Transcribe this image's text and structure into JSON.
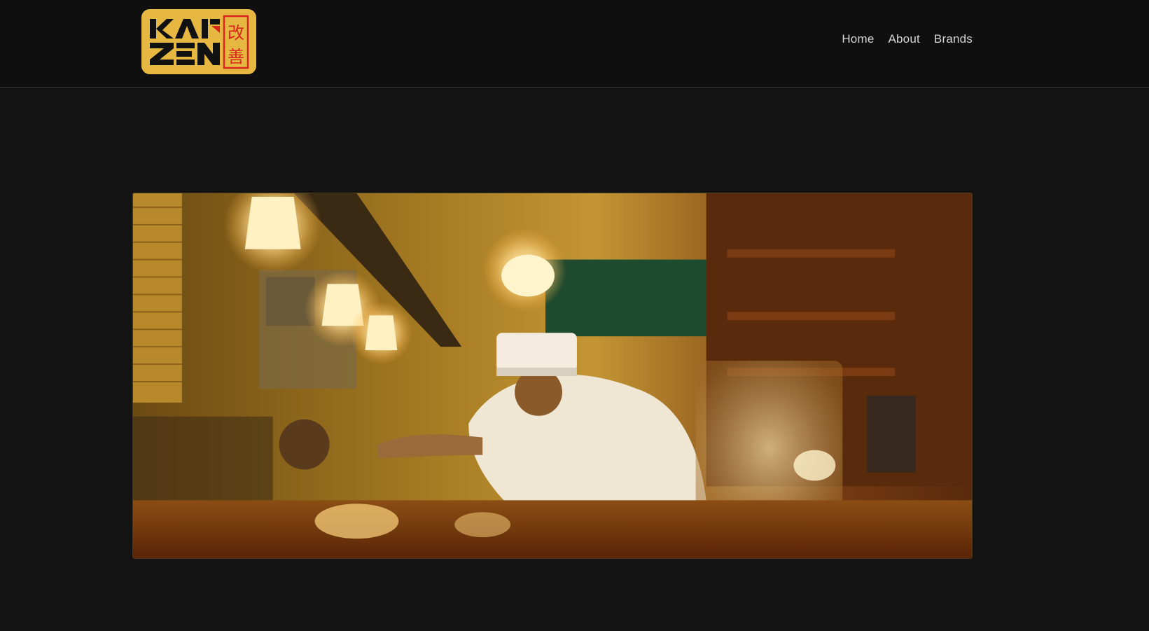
{
  "logo": {
    "latin_text": "KAIZEN",
    "kanji_top": "改",
    "kanji_bottom": "善",
    "colors": {
      "gold": "#E6B842",
      "black": "#111111",
      "red": "#D9261C"
    }
  },
  "nav": {
    "items": [
      {
        "label": "Home"
      },
      {
        "label": "About"
      },
      {
        "label": "Brands"
      }
    ]
  },
  "hero": {
    "image_icon": "restaurant-photo"
  },
  "colors": {
    "background": "#131313",
    "header_background": "#0f0f0f",
    "nav_text": "#d6d6d6"
  }
}
